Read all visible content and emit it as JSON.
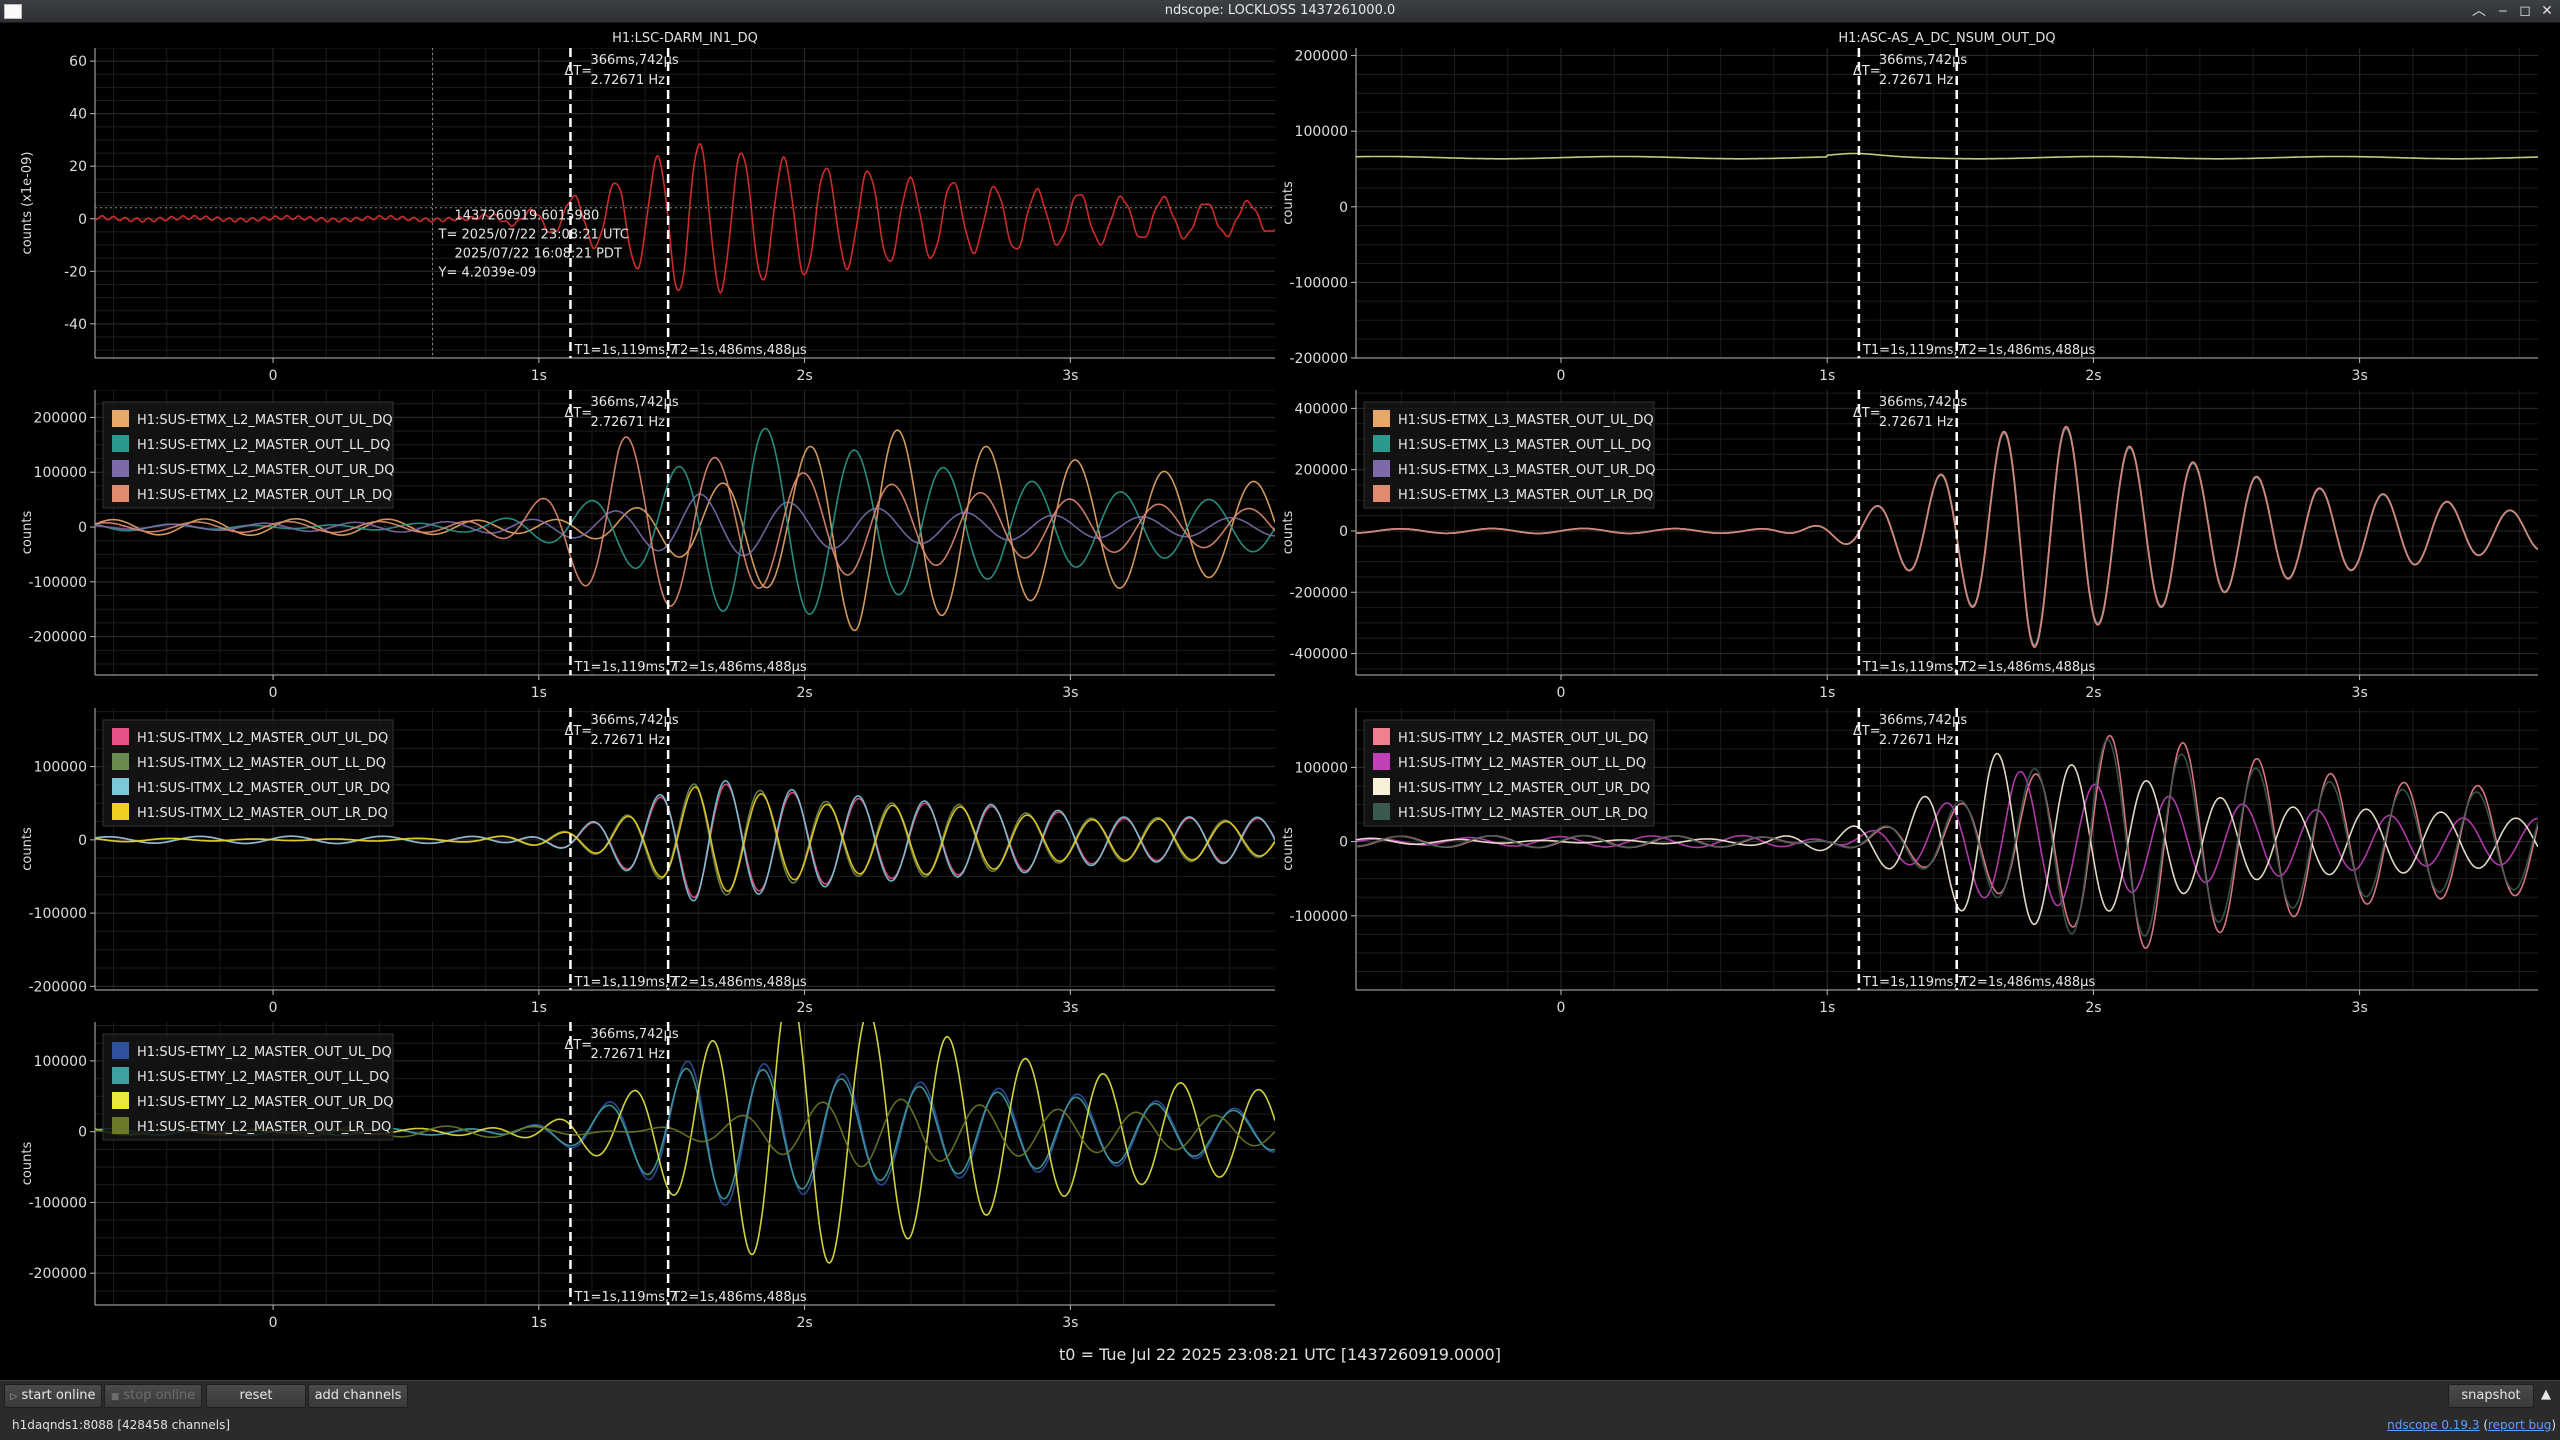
{
  "window": {
    "title": "ndscope: LOCKLOSS 1437261000.0"
  },
  "cursors": {
    "delta_label": "ΔT=",
    "delta_time": "366ms,742µs",
    "delta_freq": "2.72671 Hz",
    "t1_label": "T1=1s,119ms,7",
    "t2_label": "T2=1s,486ms,488µs",
    "t1_value": 1.119,
    "t2_value": 1.4865
  },
  "crosshair": {
    "gps": "1437260919.6015980",
    "utc": "T= 2025/07/22 23:08:21 UTC",
    "pdt": "2025/07/22 16:08:21 PDT",
    "y": "Y= 4.2039e-09"
  },
  "x_ticks": [
    {
      "value": 0,
      "label": "0"
    },
    {
      "value": 1,
      "label": "1s"
    },
    {
      "value": 2,
      "label": "2s"
    },
    {
      "value": 3,
      "label": "3s"
    }
  ],
  "t0_label": "t0 = Tue Jul 22 2025 23:08:21 UTC [1437260919.0000]",
  "toolbar": {
    "start_online": "start online",
    "stop_online": "stop online",
    "reset": "reset",
    "add_channels": "add channels",
    "snapshot": "snapshot"
  },
  "status": {
    "server": "h1daqnds1:8088  [428458 channels]",
    "version_link": "ndscope 0.19.3",
    "report_bug": "report bug"
  },
  "chart_data": [
    {
      "type": "line",
      "title": "H1:LSC-DARM_IN1_DQ",
      "ylabel": "counts (x1e-09)",
      "xlim": [
        -0.67,
        3.77
      ],
      "ylim": [
        -53,
        65
      ],
      "yticks": [
        -40,
        -20,
        0,
        20,
        40,
        60
      ],
      "grid": true,
      "legend": false,
      "series": [
        {
          "color": "#e03030",
          "name": "",
          "signal": {
            "base": 1.2,
            "baseFreq": 23,
            "t0": 0.62,
            "amp": 30,
            "freq": 6.3,
            "tpeak": 1.55,
            "rise": 0.35,
            "decay": 1.3,
            "phase": 0.3
          }
        }
      ]
    },
    {
      "type": "line",
      "title": "H1:ASC-AS_A_DC_NSUM_OUT_DQ",
      "ylabel": "counts",
      "xlim": [
        -0.77,
        3.67
      ],
      "ylim": [
        -200000,
        210000
      ],
      "yticks": [
        -200000,
        -100000,
        0,
        100000,
        200000
      ],
      "grid": true,
      "legend": false,
      "series": [
        {
          "color": "#d9e08a",
          "name": "",
          "flat": 65000
        }
      ]
    },
    {
      "type": "line",
      "title": "",
      "ylabel": "counts",
      "xlim": [
        -0.67,
        3.77
      ],
      "ylim": [
        -270000,
        250000
      ],
      "yticks": [
        -200000,
        -100000,
        0,
        100000,
        200000
      ],
      "grid": true,
      "legend": true,
      "series": [
        {
          "name": "H1:SUS-ETMX_L2_MASTER_OUT_UL_DQ",
          "color": "#e8a868",
          "signal": {
            "base": 15000,
            "baseFreq": 3,
            "t0": 0.6,
            "amp": 190000,
            "freq": 3.0,
            "tpeak": 2.2,
            "rise": 0.5,
            "decay": 1.6,
            "phase": 0.0
          }
        },
        {
          "name": "H1:SUS-ETMX_L2_MASTER_OUT_LL_DQ",
          "color": "#2a9a8c",
          "signal": {
            "base": 15000,
            "baseFreq": 3,
            "t0": 0.6,
            "amp": 180000,
            "freq": 3.0,
            "tpeak": 1.8,
            "rise": 0.45,
            "decay": 1.4,
            "phase": 3.14
          }
        },
        {
          "name": "H1:SUS-ETMX_L2_MASTER_OUT_UR_DQ",
          "color": "#7e6aa8",
          "signal": {
            "base": 10000,
            "baseFreq": 3,
            "t0": 0.6,
            "amp": 60000,
            "freq": 3.0,
            "tpeak": 1.6,
            "rise": 0.4,
            "decay": 1.3,
            "phase": 1.6
          }
        },
        {
          "name": "H1:SUS-ETMX_L2_MASTER_OUT_LR_DQ",
          "color": "#e08a70",
          "signal": {
            "base": 10000,
            "baseFreq": 3,
            "t0": 0.6,
            "amp": 170000,
            "freq": 3.0,
            "tpeak": 1.3,
            "rise": 0.4,
            "decay": 1.3,
            "phase": 0.4
          }
        }
      ]
    },
    {
      "type": "line",
      "title": "",
      "ylabel": "counts",
      "xlim": [
        -0.77,
        3.67
      ],
      "ylim": [
        -470000,
        460000
      ],
      "yticks": [
        -400000,
        -200000,
        0,
        200000,
        400000
      ],
      "grid": true,
      "legend": true,
      "series": [
        {
          "name": "H1:SUS-ETMX_L3_MASTER_OUT_UL_DQ",
          "color": "#e8a868",
          "signal": {
            "base": 8000,
            "baseFreq": 3,
            "t0": 0.65,
            "amp": 390000,
            "freq": 4.2,
            "tpeak": 1.75,
            "rise": 0.45,
            "decay": 1.1,
            "phase": 0.0
          }
        },
        {
          "name": "H1:SUS-ETMX_L3_MASTER_OUT_LL_DQ",
          "color": "#2a9a8c",
          "signal": {
            "base": 8000,
            "baseFreq": 3,
            "t0": 0.65,
            "amp": 385000,
            "freq": 4.2,
            "tpeak": 1.75,
            "rise": 0.45,
            "decay": 1.1,
            "phase": 0.02
          }
        },
        {
          "name": "H1:SUS-ETMX_L3_MASTER_OUT_UR_DQ",
          "color": "#7e6aa8",
          "signal": {
            "base": 8000,
            "baseFreq": 3,
            "t0": 0.65,
            "amp": 388000,
            "freq": 4.2,
            "tpeak": 1.75,
            "rise": 0.45,
            "decay": 1.1,
            "phase": 0.01
          }
        },
        {
          "name": "H1:SUS-ETMX_L3_MASTER_OUT_LR_DQ",
          "color": "#e08a70",
          "signal": {
            "base": 8000,
            "baseFreq": 3,
            "t0": 0.65,
            "amp": 392000,
            "freq": 4.2,
            "tpeak": 1.75,
            "rise": 0.45,
            "decay": 1.1,
            "phase": 0.03
          }
        }
      ]
    },
    {
      "type": "line",
      "title": "",
      "ylabel": "counts",
      "xlim": [
        -0.67,
        3.77
      ],
      "ylim": [
        -205000,
        180000
      ],
      "yticks": [
        -200000,
        -100000,
        0,
        100000
      ],
      "grid": true,
      "legend": true,
      "series": [
        {
          "name": "H1:SUS-ITMX_L2_MASTER_OUT_UL_DQ",
          "color": "#e8508a",
          "signal": {
            "base": 5000,
            "baseFreq": 3,
            "t0": 0.65,
            "amp": 80000,
            "freq": 4.0,
            "tpeak": 1.6,
            "rise": 0.4,
            "decay": 1.8,
            "phase": 0.2
          }
        },
        {
          "name": "H1:SUS-ITMX_L2_MASTER_OUT_LL_DQ",
          "color": "#6b8a4e",
          "signal": {
            "base": 5000,
            "baseFreq": 3,
            "t0": 0.65,
            "amp": 75000,
            "freq": 4.0,
            "tpeak": 1.6,
            "rise": 0.4,
            "decay": 1.8,
            "phase": 3.3
          }
        },
        {
          "name": "H1:SUS-ITMX_L2_MASTER_OUT_UR_DQ",
          "color": "#7ac8d8",
          "signal": {
            "base": 5000,
            "baseFreq": 3,
            "t0": 0.65,
            "amp": 85000,
            "freq": 4.0,
            "tpeak": 1.6,
            "rise": 0.4,
            "decay": 1.8,
            "phase": 0.25
          }
        },
        {
          "name": "H1:SUS-ITMX_L2_MASTER_OUT_LR_DQ",
          "color": "#f0d020",
          "signal": {
            "base": 5000,
            "baseFreq": 3,
            "t0": 0.65,
            "amp": 70000,
            "freq": 4.0,
            "tpeak": 1.6,
            "rise": 0.4,
            "decay": 1.8,
            "phase": 3.2
          }
        }
      ]
    },
    {
      "type": "line",
      "title": "",
      "ylabel": "counts",
      "xlim": [
        -0.77,
        3.67
      ],
      "ylim": [
        -200000,
        180000
      ],
      "yticks": [
        -100000,
        0,
        100000
      ],
      "grid": true,
      "legend": true,
      "series": [
        {
          "name": "H1:SUS-ITMY_L2_MASTER_OUT_UL_DQ",
          "color": "#f08090",
          "signal": {
            "base": 8000,
            "baseFreq": 3,
            "t0": 0.6,
            "amp": 150000,
            "freq": 3.6,
            "tpeak": 2.1,
            "rise": 0.5,
            "decay": 1.8,
            "phase": 0.0
          }
        },
        {
          "name": "H1:SUS-ITMY_L2_MASTER_OUT_LL_DQ",
          "color": "#c040b8",
          "signal": {
            "base": 8000,
            "baseFreq": 3,
            "t0": 0.6,
            "amp": 90000,
            "freq": 3.6,
            "tpeak": 1.7,
            "rise": 0.45,
            "decay": 1.6,
            "phase": 1.2
          }
        },
        {
          "name": "H1:SUS-ITMY_L2_MASTER_OUT_UR_DQ",
          "color": "#f8f0d8",
          "signal": {
            "base": 8000,
            "baseFreq": 3,
            "t0": 0.6,
            "amp": 120000,
            "freq": 3.6,
            "tpeak": 1.6,
            "rise": 0.45,
            "decay": 1.4,
            "phase": 3.14
          }
        },
        {
          "name": "H1:SUS-ITMY_L2_MASTER_OUT_LR_DQ",
          "color": "#3a5a50",
          "signal": {
            "base": 8000,
            "baseFreq": 3,
            "t0": 0.6,
            "amp": 140000,
            "freq": 3.6,
            "tpeak": 2.0,
            "rise": 0.5,
            "decay": 1.8,
            "phase": 0.1
          }
        }
      ]
    },
    {
      "type": "line",
      "title": "",
      "ylabel": "counts",
      "xlim": [
        -0.67,
        3.77
      ],
      "ylim": [
        -245000,
        155000
      ],
      "yticks": [
        -200000,
        -100000,
        0,
        100000
      ],
      "grid": true,
      "legend": true,
      "series": [
        {
          "name": "H1:SUS-ETMY_L2_MASTER_OUT_UL_DQ",
          "color": "#3050a0",
          "signal": {
            "base": 5000,
            "baseFreq": 3,
            "t0": 0.6,
            "amp": 110000,
            "freq": 3.4,
            "tpeak": 1.6,
            "rise": 0.45,
            "decay": 1.8,
            "phase": 0.0
          }
        },
        {
          "name": "H1:SUS-ETMY_L2_MASTER_OUT_LL_DQ",
          "color": "#40a0a0",
          "signal": {
            "base": 5000,
            "baseFreq": 3,
            "t0": 0.6,
            "amp": 100000,
            "freq": 3.4,
            "tpeak": 1.6,
            "rise": 0.45,
            "decay": 1.8,
            "phase": 0.1
          }
        },
        {
          "name": "H1:SUS-ETMY_L2_MASTER_OUT_UR_DQ",
          "color": "#e8e840",
          "signal": {
            "base": 10000,
            "baseFreq": 3,
            "t0": 0.55,
            "amp": 200000,
            "freq": 3.4,
            "tpeak": 1.9,
            "rise": 0.5,
            "decay": 1.5,
            "phase": 3.14
          }
        },
        {
          "name": "H1:SUS-ETMY_L2_MASTER_OUT_LR_DQ",
          "color": "#6a7a28",
          "signal": {
            "base": 8000,
            "baseFreq": 3,
            "t0": 0.6,
            "amp": 45000,
            "freq": 3.4,
            "tpeak": 2.2,
            "rise": 0.5,
            "decay": 2.0,
            "phase": 1.6
          }
        }
      ]
    }
  ]
}
